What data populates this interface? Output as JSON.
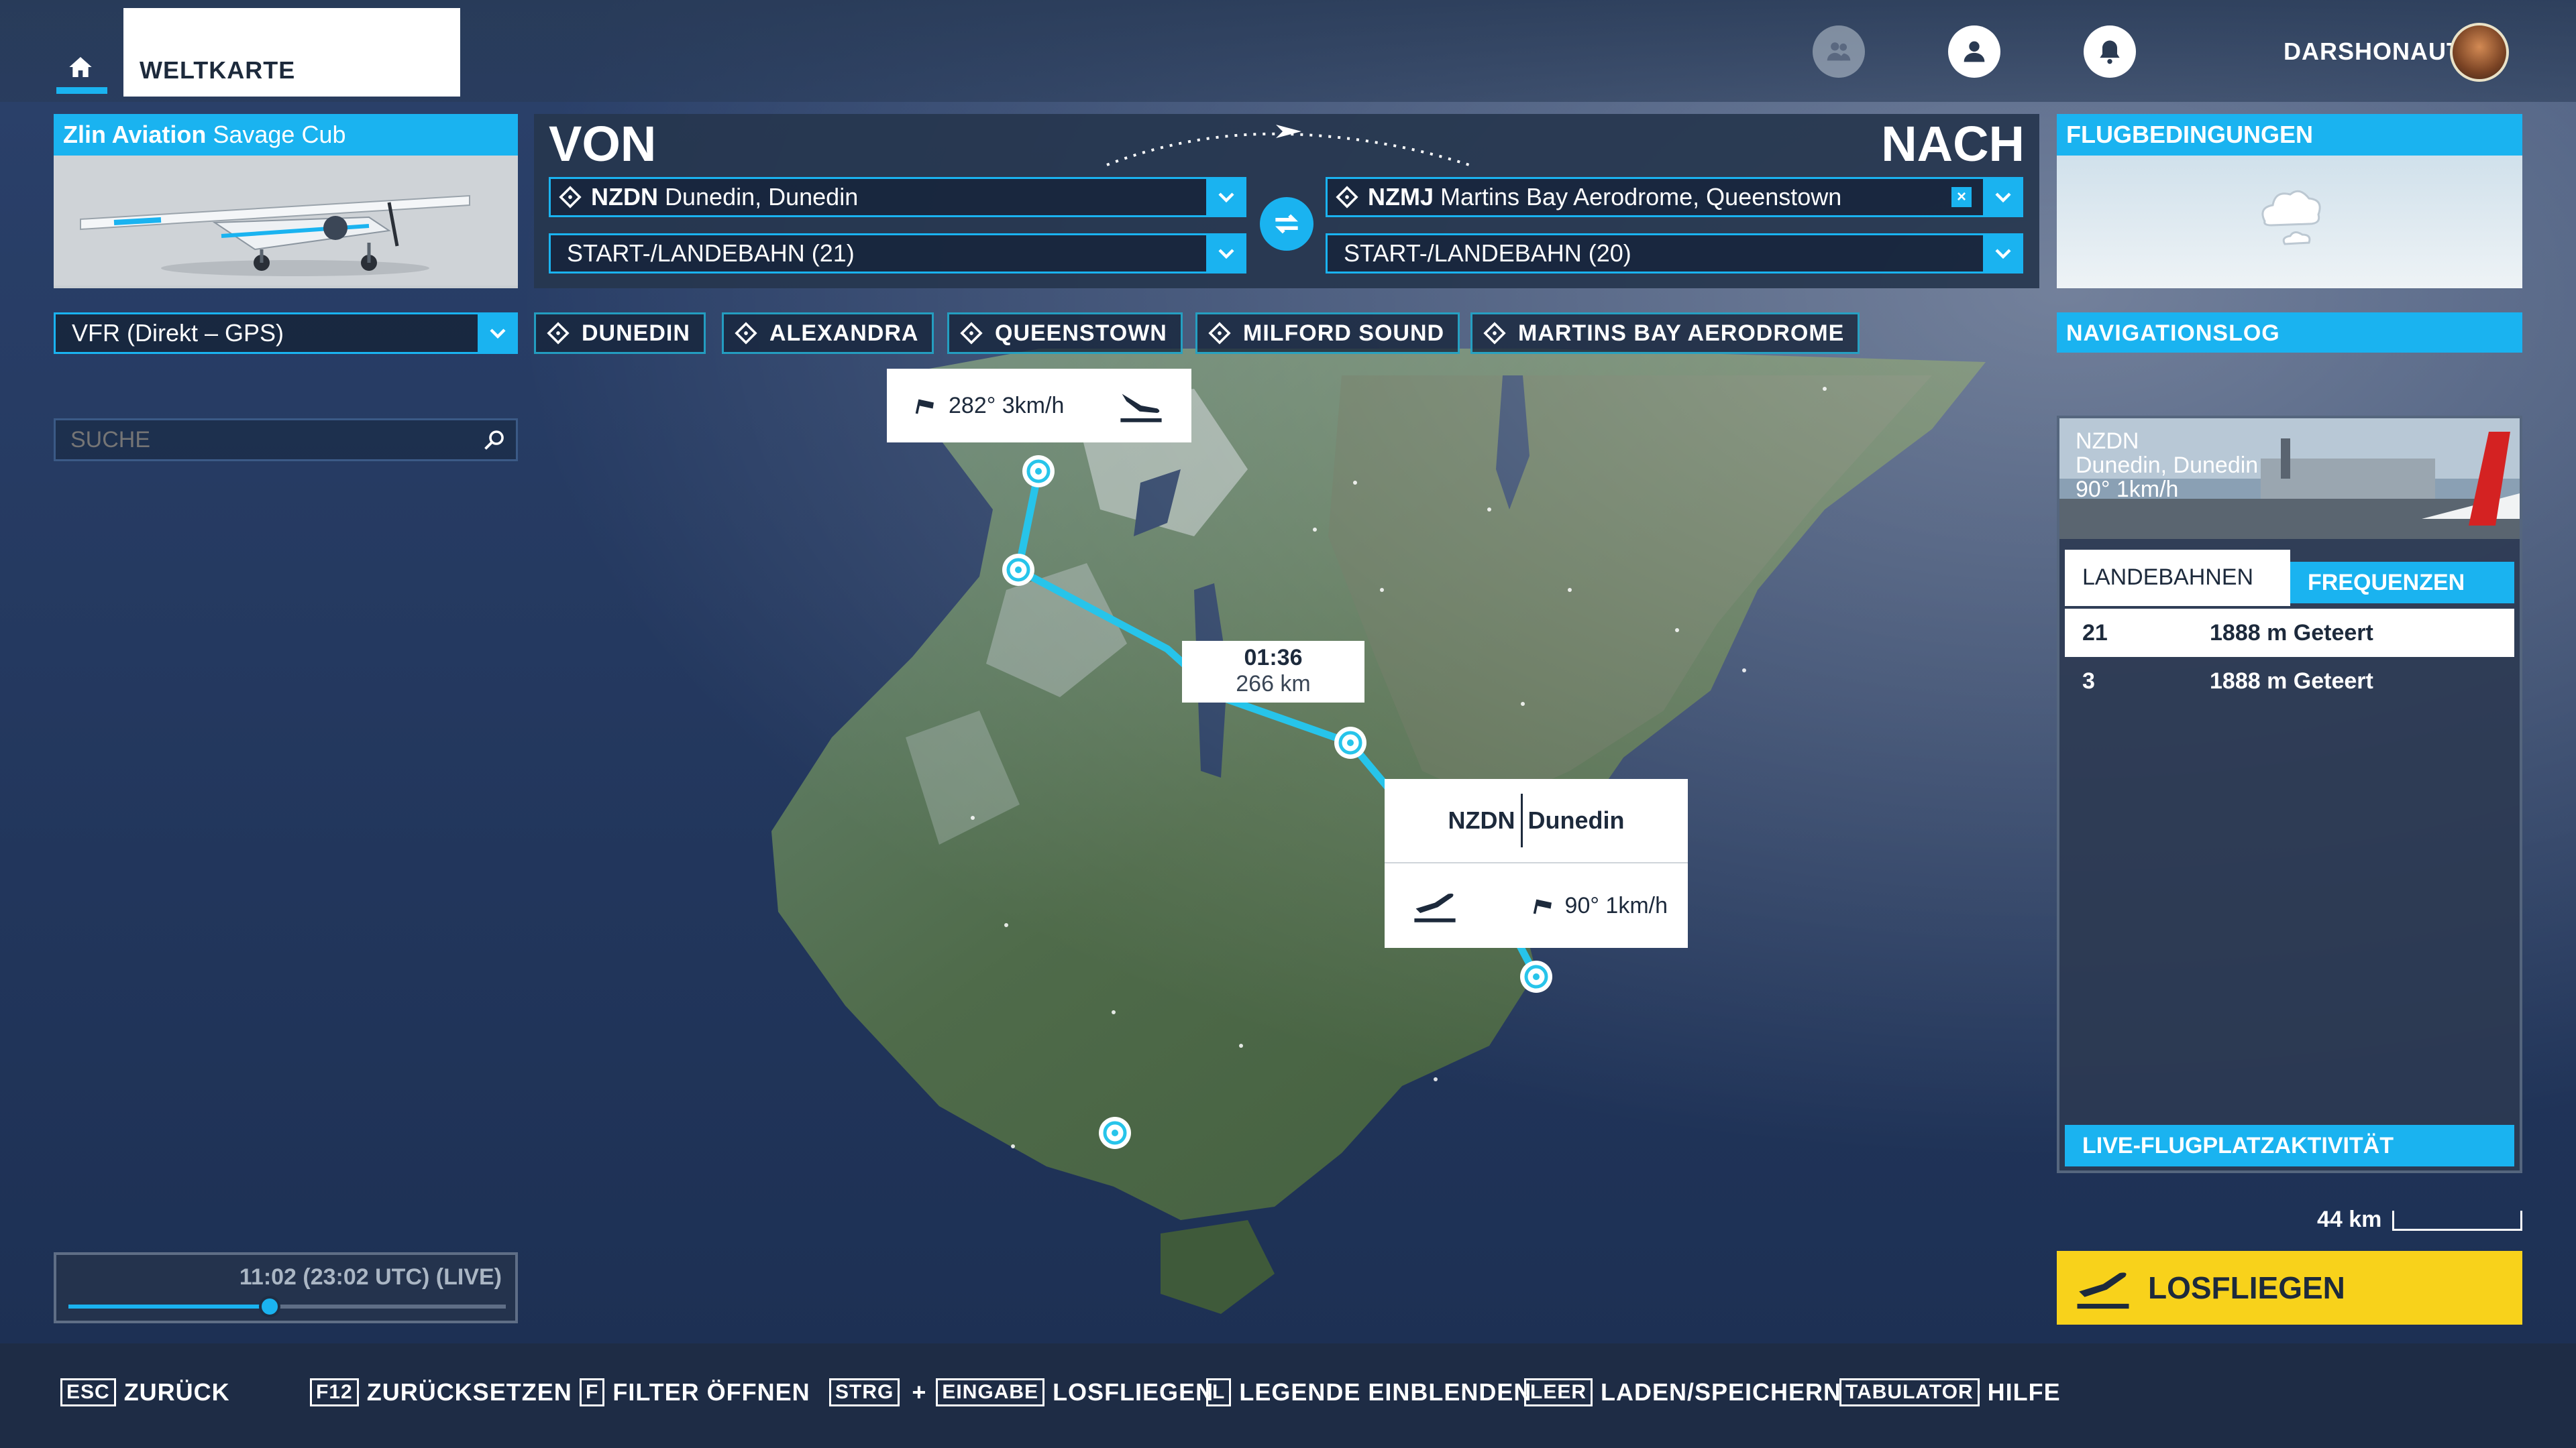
{
  "topbar": {
    "tab_label": "WELTKARTE",
    "user_name": "DARSHONAUT",
    "icons": [
      "home-icon",
      "friends-icon",
      "profile-icon",
      "notification-bell-icon"
    ]
  },
  "aircraft": {
    "brand": "Zlin Aviation",
    "model": "Savage Cub"
  },
  "route": {
    "from_heading": "VON",
    "to_heading": "NACH",
    "from_code": "NZDN",
    "from_name": "Dunedin, Dunedin",
    "from_runway": "START-/LANDEBAHN (21)",
    "to_code": "NZMJ",
    "to_name": "Martins Bay Aerodrome, Queenstown",
    "to_runway": "START-/LANDEBAHN (20)",
    "flight_mode": "VFR (Direkt – GPS)",
    "waypoints": [
      "DUNEDIN",
      "ALEXANDRA",
      "QUEENSTOWN",
      "MILFORD SOUND",
      "MARTINS BAY AERODROME"
    ]
  },
  "conditions": {
    "title": "FLUGBEDINGUNGEN"
  },
  "navlog": {
    "title": "NAVIGATIONSLOG"
  },
  "search": {
    "placeholder": "SUCHE"
  },
  "map": {
    "dest_wind": "282° 3km/h",
    "leg_time": "01:36",
    "leg_distance": "266 km",
    "origin_code": "NZDN",
    "origin_name": "Dunedin",
    "origin_wind": "90° 1km/h",
    "scale_label": "44 km"
  },
  "airport_card": {
    "code": "NZDN",
    "name": "Dunedin, Dunedin",
    "wind": "90° 1km/h",
    "tab_runways": "LANDEBAHNEN",
    "tab_frequencies": "FREQUENZEN",
    "runways": [
      {
        "id": "21",
        "desc": "1888 m Geteert"
      },
      {
        "id": "3",
        "desc": "1888 m Geteert"
      }
    ],
    "live_activity": "LIVE-FLUGPLATZAKTIVITÄT"
  },
  "time": {
    "label": "11:02 (23:02 UTC) (LIVE)",
    "slider_fraction": 0.46
  },
  "fly_button": "LOSFLIEGEN",
  "keybar": {
    "back_key": "ESC",
    "back_label": "ZURÜCK",
    "reset_key": "F12",
    "reset_label": "ZURÜCKSETZEN",
    "filter_key": "F",
    "filter_label": "FILTER ÖFFNEN",
    "fly_key1": "STRG",
    "fly_plus": "+",
    "fly_key2": "EINGABE",
    "fly_label": "LOSFLIEGEN",
    "legend_key": "L",
    "legend_label": "LEGENDE EINBLENDEN",
    "save_key": "LEER",
    "save_label": "LADEN/SPEICHERN",
    "help_key": "TABULATOR",
    "help_label": "HILFE"
  },
  "colors": {
    "accent": "#1ab3f0",
    "route": "#27c4ea",
    "fly_button": "#f8d21b"
  }
}
